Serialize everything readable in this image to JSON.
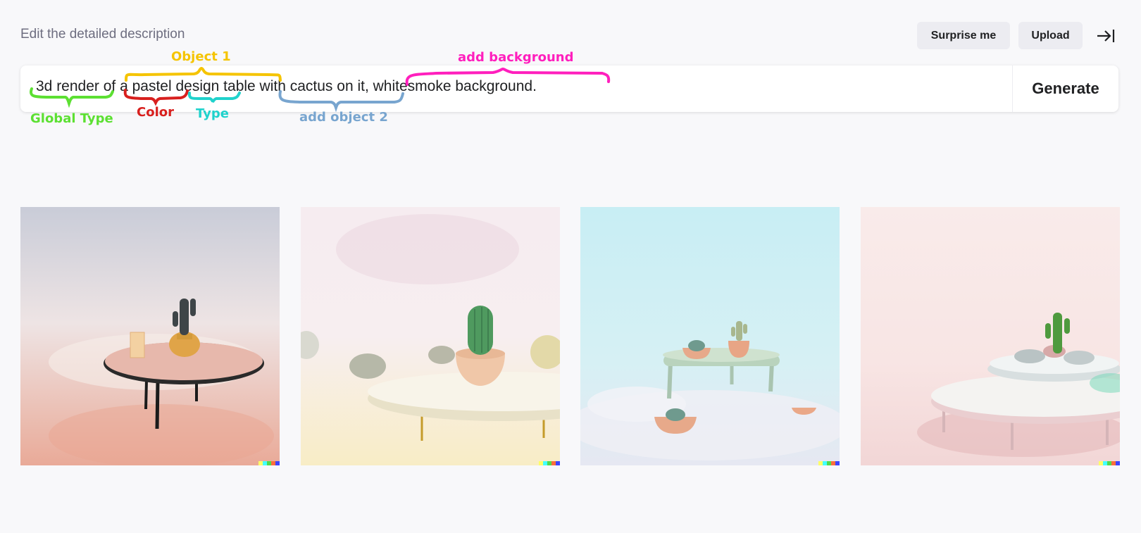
{
  "header": {
    "edit_label": "Edit the detailed description",
    "surprise_label": "Surprise me",
    "upload_label": "Upload"
  },
  "prompt": {
    "text": "3d render of a pastel design table with cactus on it, whitesmoke background.",
    "generate_label": "Generate"
  },
  "annotations": {
    "object1": "Object 1",
    "add_background": "add background",
    "global_type": "Global Type",
    "color": "Color",
    "type": "Type",
    "add_object2": "add object 2",
    "colors": {
      "object1": "#f5c400",
      "add_background": "#ff1fbd",
      "global_type": "#5ce032",
      "color": "#d8201e",
      "type": "#1fd2cc",
      "add_object2": "#78a5cf"
    }
  },
  "results": {
    "images": [
      {
        "subject": "round table with black legs and cactus pot"
      },
      {
        "subject": "white round table with cactus bowl"
      },
      {
        "subject": "mint table with small cacti on cyan backdrop"
      },
      {
        "subject": "pink round table with cactus tray"
      }
    ]
  }
}
